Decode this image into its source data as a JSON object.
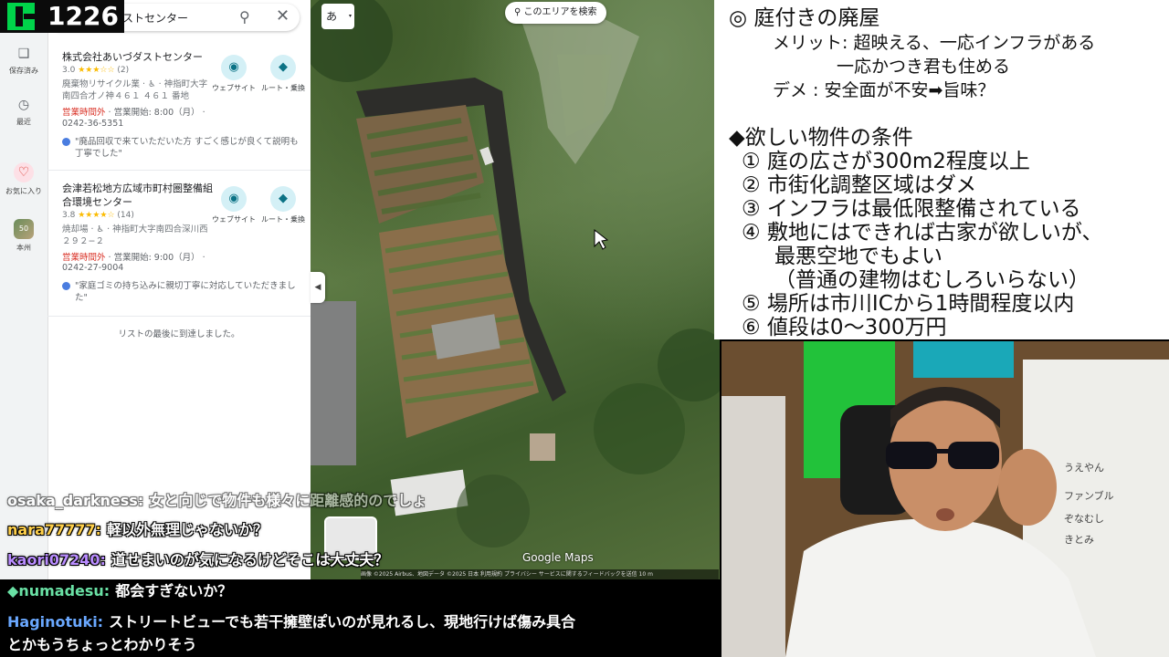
{
  "stream": {
    "viewer_count": "1226"
  },
  "maps": {
    "search_text": "ストセンター",
    "rail": [
      {
        "label": "保存済み",
        "icon": "bookmark-icon"
      },
      {
        "label": "最近",
        "icon": "history-icon"
      },
      {
        "label": "お気に入り",
        "icon": "heart-icon"
      },
      {
        "label": "本州",
        "icon": "place-thumb",
        "badge": "50"
      }
    ],
    "results": [
      {
        "name": "株式会社あいづダストセンター",
        "rating": "3.0",
        "stars": "★★★☆☆",
        "count": "(2)",
        "category": "廃棄物リサイクル業 · ♿ · 神指町大字南四合才ノ神４６１ ４６１ 番地",
        "status": "営業時間外",
        "opens": " · 営業開始: 8:00（月） ·",
        "phone": "0242-36-5351",
        "review": "\"廃品回収で来ていただいた方 すごく感じが良くて説明も丁寧でした\"",
        "website_label": "ウェブサイト",
        "route_label": "ルート・乗換"
      },
      {
        "name": "会津若松地方広域市町村圏整備組合環境センター",
        "rating": "3.8",
        "stars": "★★★★☆",
        "count": "(14)",
        "category": "焼却場 · ♿ · 神指町大字南四合深川西２９２−２",
        "status": "営業時間外",
        "opens": " · 営業開始: 9:00（月） ·",
        "phone": "0242-27-9004",
        "review": "\"家庭ゴミの持ち込みに親切丁寧に対応していただきました\"",
        "website_label": "ウェブサイト",
        "route_label": "ルート・乗換"
      }
    ],
    "end_of_list": "リストの最後に到達しました。",
    "ime_label": "あ",
    "search_area_button": "このエリアを検索",
    "brand": "Google Maps",
    "footer": "画像 ©2025 Airbus、地図データ ©2025   日本   利用規約   プライバシー   サービスに関するフィードバックを送信   10 m"
  },
  "chat": [
    {
      "user": "osaka_darkness:",
      "text": "女と向じで物件も様々に距離感的のでしょ",
      "color": "#ffffff",
      "partial": true
    },
    {
      "user": "nara77777:",
      "text": "軽以外無理じゃないか？",
      "color": "#ffd04a"
    },
    {
      "user": "kaori07240:",
      "text": "道せまいのが気になるけどそこは大丈夫？",
      "color": "#b98cff"
    },
    {
      "user": "numadesu:",
      "text": "都会すぎないか？",
      "color": "#69e0a4",
      "prefix": "◆"
    },
    {
      "user": "Haginotuki:",
      "text": "ストリートビューでも若干擁壁ぽいのが見れるし、現地行けば傷み具合",
      "color": "#6aa8ff"
    },
    {
      "user": "",
      "text": "とかもうちょっとわかりそう",
      "color": "#ffffff"
    }
  ],
  "notes": {
    "heading": "◎ 庭付きの廃屋",
    "merit_line1": "メリット: 超映える、一応インフラがある",
    "merit_line2": "一応かつき君も住める",
    "demerit": "デメ : 安全面が不安➡旨味？",
    "conditions_title": "◆欲しい物件の条件",
    "conditions": [
      "① 庭の広さが300m2程度以上",
      "② 市街化調整区域はダメ",
      "③ インフラは最低限整備されている",
      "④ 敷地にはできれば古家が欲しいが、",
      "最悪空地でもよい",
      "（普通の建物はむしろいらない）",
      "⑤ 場所は市川ICから1時間程度以内",
      "⑥ 値段は0〜300万円"
    ]
  },
  "webcam": {
    "sidebar_names": [
      "うえやん",
      "ファンブル",
      "ぞなむし",
      "きとみ"
    ]
  }
}
